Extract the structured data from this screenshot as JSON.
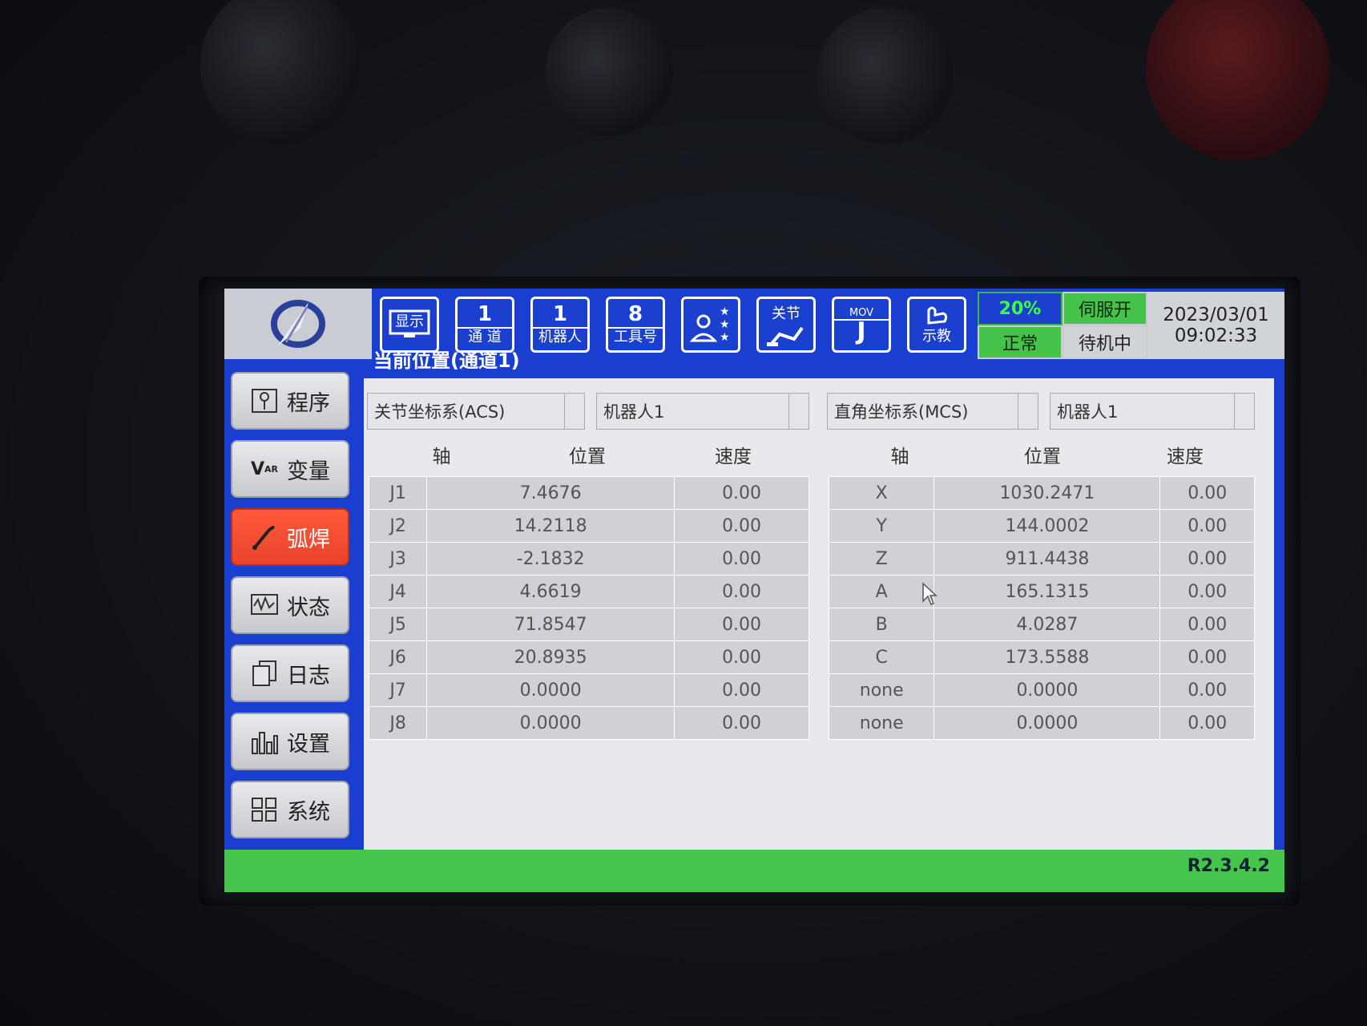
{
  "toolbar": {
    "display": "显示",
    "channel": {
      "num": "1",
      "label": "通 道"
    },
    "robot": {
      "num": "1",
      "label": "机器人"
    },
    "tool": {
      "num": "8",
      "label": "工具号"
    },
    "joint": "关节",
    "mov": {
      "top": "MOV",
      "letter": "J"
    },
    "teach": "示教"
  },
  "status": {
    "speed": "20%",
    "servo": "伺服开",
    "state": "正常",
    "mode": "待机中",
    "date": "2023/03/01",
    "time": "09:02:33"
  },
  "sidebar": {
    "items": [
      {
        "label": "程序"
      },
      {
        "label": "变量"
      },
      {
        "label": "弧焊"
      },
      {
        "label": "状态"
      },
      {
        "label": "日志"
      },
      {
        "label": "设置"
      },
      {
        "label": "系统"
      }
    ]
  },
  "main": {
    "title": "当前位置(通道1)",
    "left": {
      "coord": "关节坐标系(ACS)",
      "robot": "机器人1",
      "headers": [
        "轴",
        "位置",
        "速度"
      ],
      "rows": [
        [
          "J1",
          "7.4676",
          "0.00"
        ],
        [
          "J2",
          "14.2118",
          "0.00"
        ],
        [
          "J3",
          "-2.1832",
          "0.00"
        ],
        [
          "J4",
          "4.6619",
          "0.00"
        ],
        [
          "J5",
          "71.8547",
          "0.00"
        ],
        [
          "J6",
          "20.8935",
          "0.00"
        ],
        [
          "J7",
          "0.0000",
          "0.00"
        ],
        [
          "J8",
          "0.0000",
          "0.00"
        ]
      ]
    },
    "right": {
      "coord": "直角坐标系(MCS)",
      "robot": "机器人1",
      "headers": [
        "轴",
        "位置",
        "速度"
      ],
      "rows": [
        [
          "X",
          "1030.2471",
          "0.00"
        ],
        [
          "Y",
          "144.0002",
          "0.00"
        ],
        [
          "Z",
          "911.4438",
          "0.00"
        ],
        [
          "A",
          "165.1315",
          "0.00"
        ],
        [
          "B",
          "4.0287",
          "0.00"
        ],
        [
          "C",
          "173.5588",
          "0.00"
        ],
        [
          "none",
          "0.0000",
          "0.00"
        ],
        [
          "none",
          "0.0000",
          "0.00"
        ]
      ]
    }
  },
  "footer": {
    "version": "R2.3.4.2"
  }
}
